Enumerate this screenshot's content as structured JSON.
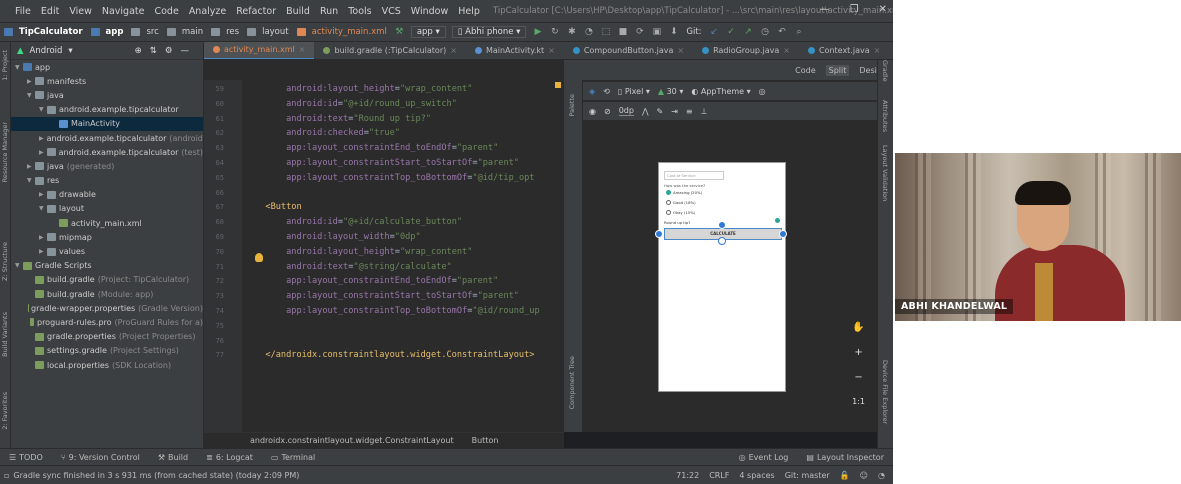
{
  "menu": {
    "items": [
      "File",
      "Edit",
      "View",
      "Navigate",
      "Code",
      "Analyze",
      "Refactor",
      "Build",
      "Run",
      "Tools",
      "VCS",
      "Window",
      "Help"
    ],
    "path": "TipCalculator [C:\\Users\\HP\\Desktop\\app\\TipCalculator] - ...\\src\\main\\res\\layout\\activity_main.xml [app]"
  },
  "toolbar": {
    "crumbs": [
      "TipCalculator",
      "app",
      "src",
      "main",
      "res",
      "layout",
      "activity_main.xml"
    ],
    "module": "app",
    "device": "Abhi phone",
    "git_label": "Git:"
  },
  "project": {
    "view": "Android",
    "rows": [
      {
        "depth": 0,
        "arrow": "▼",
        "icon": "fold-b",
        "label": "app",
        "dim": ""
      },
      {
        "depth": 1,
        "arrow": "▶",
        "icon": "fold",
        "label": "manifests",
        "dim": ""
      },
      {
        "depth": 1,
        "arrow": "▼",
        "icon": "fold",
        "label": "java",
        "dim": ""
      },
      {
        "depth": 2,
        "arrow": "▼",
        "icon": "fold",
        "label": "android.example.tipcalculator",
        "dim": ""
      },
      {
        "depth": 3,
        "arrow": "",
        "icon": "file-k",
        "label": "MainActivity",
        "dim": "",
        "sel": true
      },
      {
        "depth": 2,
        "arrow": "▶",
        "icon": "fold",
        "label": "android.example.tipcalculator",
        "dim": "(androidTest)"
      },
      {
        "depth": 2,
        "arrow": "▶",
        "icon": "fold",
        "label": "android.example.tipcalculator",
        "dim": "(test)"
      },
      {
        "depth": 1,
        "arrow": "▶",
        "icon": "fold",
        "label": "java",
        "dim": "(generated)"
      },
      {
        "depth": 1,
        "arrow": "▼",
        "icon": "fold",
        "label": "res",
        "dim": ""
      },
      {
        "depth": 2,
        "arrow": "▶",
        "icon": "fold",
        "label": "drawable",
        "dim": ""
      },
      {
        "depth": 2,
        "arrow": "▼",
        "icon": "fold",
        "label": "layout",
        "dim": ""
      },
      {
        "depth": 3,
        "arrow": "",
        "icon": "file-g",
        "label": "activity_main.xml",
        "dim": ""
      },
      {
        "depth": 2,
        "arrow": "▶",
        "icon": "fold",
        "label": "mipmap",
        "dim": ""
      },
      {
        "depth": 2,
        "arrow": "▶",
        "icon": "fold",
        "label": "values",
        "dim": ""
      },
      {
        "depth": 0,
        "arrow": "▼",
        "icon": "file-g",
        "label": "Gradle Scripts",
        "dim": ""
      },
      {
        "depth": 1,
        "arrow": "",
        "icon": "file-g",
        "label": "build.gradle",
        "dim": "(Project: TipCalculator)"
      },
      {
        "depth": 1,
        "arrow": "",
        "icon": "file-g",
        "label": "build.gradle",
        "dim": "(Module: app)"
      },
      {
        "depth": 1,
        "arrow": "",
        "icon": "file-g",
        "label": "gradle-wrapper.properties",
        "dim": "(Gradle Version)"
      },
      {
        "depth": 1,
        "arrow": "",
        "icon": "file-g",
        "label": "proguard-rules.pro",
        "dim": "(ProGuard Rules for a)"
      },
      {
        "depth": 1,
        "arrow": "",
        "icon": "file-g",
        "label": "gradle.properties",
        "dim": "(Project Properties)"
      },
      {
        "depth": 1,
        "arrow": "",
        "icon": "file-g",
        "label": "settings.gradle",
        "dim": "(Project Settings)"
      },
      {
        "depth": 1,
        "arrow": "",
        "icon": "file-g",
        "label": "local.properties",
        "dim": "(SDK Location)"
      }
    ]
  },
  "tabs": [
    {
      "label": "activity_main.xml",
      "active": true,
      "color": "#e08855"
    },
    {
      "label": "build.gradle (:TipCalculator)",
      "active": false,
      "color": "#7c9c5c"
    },
    {
      "label": "MainActivity.kt",
      "active": false,
      "color": "#5a8fd0"
    },
    {
      "label": "CompoundButton.java",
      "active": false,
      "color": "#3592c4"
    },
    {
      "label": "RadioGroup.java",
      "active": false,
      "color": "#3592c4"
    },
    {
      "label": "Context.java",
      "active": false,
      "color": "#3592c4"
    },
    {
      "label": "E",
      "active": false,
      "color": "#3592c4"
    }
  ],
  "modes": [
    "Code",
    "Split",
    "Design"
  ],
  "code": [
    {
      "n": "59",
      "parts": [
        [
          "ns",
          "    android:"
        ],
        [
          "attr",
          "layout_height"
        ],
        [
          "plain",
          "="
        ],
        [
          "str",
          "\"wrap_content\""
        ]
      ]
    },
    {
      "n": "60",
      "parts": [
        [
          "ns",
          "    android:"
        ],
        [
          "attr",
          "id"
        ],
        [
          "plain",
          "="
        ],
        [
          "str",
          "\"@+id/round_up_switch\""
        ]
      ]
    },
    {
      "n": "61",
      "parts": [
        [
          "ns",
          "    android:"
        ],
        [
          "attr",
          "text"
        ],
        [
          "plain",
          "="
        ],
        [
          "str",
          "\"Round up tip?\""
        ]
      ]
    },
    {
      "n": "62",
      "parts": [
        [
          "ns",
          "    android:"
        ],
        [
          "attr",
          "checked"
        ],
        [
          "plain",
          "="
        ],
        [
          "str",
          "\"true\""
        ]
      ]
    },
    {
      "n": "63",
      "parts": [
        [
          "ns",
          "    app:"
        ],
        [
          "attr",
          "layout_constraintEnd_toEndOf"
        ],
        [
          "plain",
          "="
        ],
        [
          "str",
          "\"parent\""
        ]
      ]
    },
    {
      "n": "64",
      "parts": [
        [
          "ns",
          "    app:"
        ],
        [
          "attr",
          "layout_constraintStart_toStartOf"
        ],
        [
          "plain",
          "="
        ],
        [
          "str",
          "\"parent\""
        ]
      ]
    },
    {
      "n": "65",
      "parts": [
        [
          "ns",
          "    app:"
        ],
        [
          "attr",
          "layout_constraintTop_toBottomOf"
        ],
        [
          "plain",
          "="
        ],
        [
          "str",
          "\"@id/tip_opt"
        ]
      ]
    },
    {
      "n": "66",
      "parts": []
    },
    {
      "n": "67",
      "parts": [
        [
          "tag",
          "<Button"
        ]
      ]
    },
    {
      "n": "68",
      "parts": [
        [
          "ns",
          "    android:"
        ],
        [
          "attr",
          "id"
        ],
        [
          "plain",
          "="
        ],
        [
          "str",
          "\"@+id/calculate_button\""
        ]
      ]
    },
    {
      "n": "69",
      "parts": [
        [
          "ns",
          "    android:"
        ],
        [
          "attr",
          "layout_width"
        ],
        [
          "plain",
          "="
        ],
        [
          "str",
          "\"0dp\""
        ]
      ]
    },
    {
      "n": "70",
      "parts": [
        [
          "ns",
          "    android:"
        ],
        [
          "attr",
          "layout_height"
        ],
        [
          "plain",
          "="
        ],
        [
          "str",
          "\"wrap_content\""
        ]
      ]
    },
    {
      "n": "71",
      "parts": [
        [
          "ns",
          "    android:"
        ],
        [
          "attr",
          "text"
        ],
        [
          "plain",
          "="
        ],
        [
          "str",
          "\"@string/calculate\""
        ]
      ]
    },
    {
      "n": "72",
      "parts": [
        [
          "ns",
          "    app:"
        ],
        [
          "attr",
          "layout_constraintEnd_toEndOf"
        ],
        [
          "plain",
          "="
        ],
        [
          "str",
          "\"parent\""
        ]
      ]
    },
    {
      "n": "73",
      "parts": [
        [
          "ns",
          "    app:"
        ],
        [
          "attr",
          "layout_constraintStart_toStartOf"
        ],
        [
          "plain",
          "="
        ],
        [
          "str",
          "\"parent\""
        ]
      ]
    },
    {
      "n": "74",
      "parts": [
        [
          "ns",
          "    app:"
        ],
        [
          "attr",
          "layout_constraintTop_toBottomOf"
        ],
        [
          "plain",
          "="
        ],
        [
          "str",
          "\"@id/round_up"
        ]
      ]
    },
    {
      "n": "75",
      "parts": []
    },
    {
      "n": "76",
      "parts": []
    },
    {
      "n": "77",
      "parts": [
        [
          "tag",
          "</androidx.constraintlayout.widget.ConstraintLayout>"
        ]
      ]
    }
  ],
  "editor_breadcrumb": [
    "androidx.constraintlayout.widget.ConstraintLayout",
    "Button"
  ],
  "design": {
    "device": "Pixel",
    "api": "30",
    "theme": "AppTheme",
    "margin": "0dp",
    "preview": {
      "input_hint": "Cost of Service",
      "question": "How was the service?",
      "options": [
        "Amazing (20%)",
        "Good (18%)",
        "Okay (15%)"
      ],
      "round": "Round up tip?",
      "button": "CALCULATE"
    },
    "zoom_ratio": "1:1",
    "side_label_palette": "Palette",
    "side_label_tree": "Component Tree"
  },
  "bottom_tools": [
    "TODO",
    "9: Version Control",
    "Build",
    "6: Logcat",
    "Terminal",
    "Event Log",
    "Layout Inspector"
  ],
  "status": {
    "message": "Gradle sync finished in 3 s 931 ms (from cached state) (today 2:09 PM)",
    "position": "71:22",
    "line_sep": "CRLF",
    "indent": "4 spaces",
    "branch": "Git: master"
  },
  "video": {
    "name": "ABHI KHANDELWAL"
  }
}
